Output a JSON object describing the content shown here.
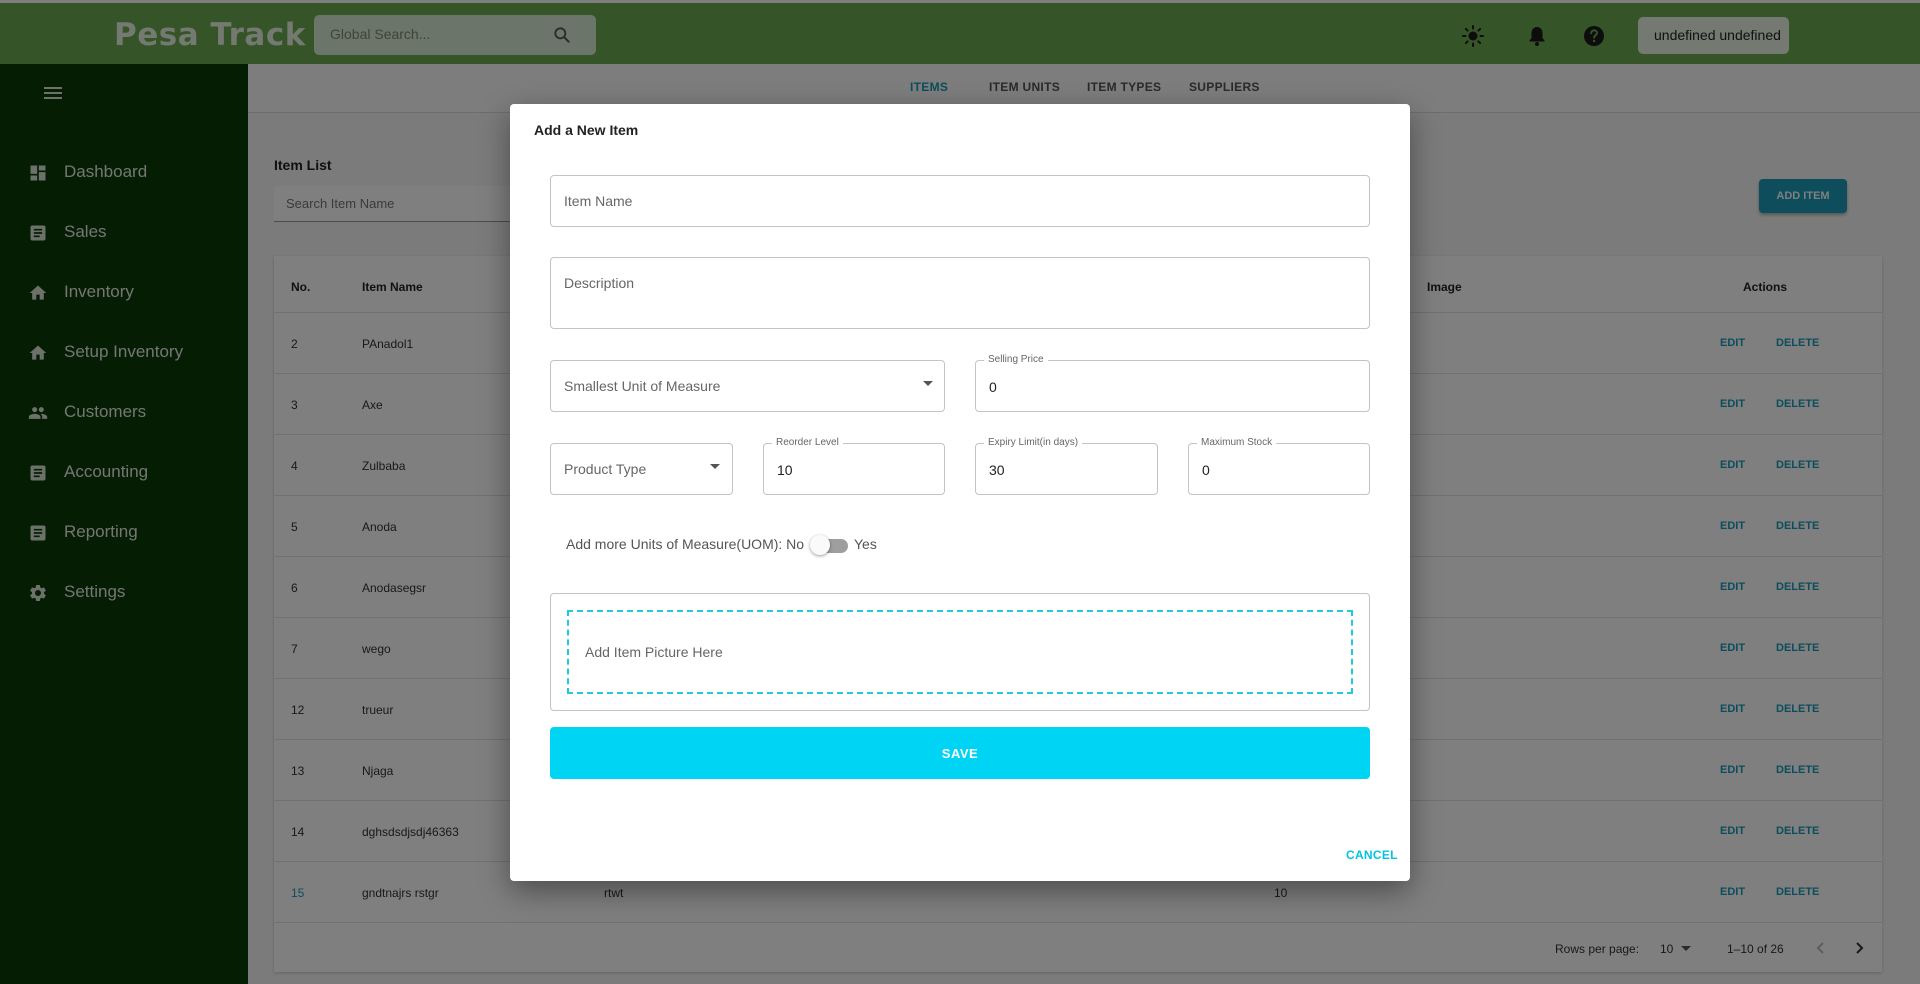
{
  "colors": {
    "header": "#6aa84f",
    "sidebar": "#0b3a05",
    "accent": "#1a9bb8",
    "save": "#00d4f5"
  },
  "header": {
    "brand": "Pesa Track",
    "search_placeholder": "Global Search...",
    "user_label": "undefined undefined",
    "icons": [
      "brightness-icon",
      "bell-icon",
      "help-icon"
    ]
  },
  "sidebar": {
    "items": [
      {
        "label": "Dashboard",
        "icon": "dashboard-icon"
      },
      {
        "label": "Sales",
        "icon": "list-icon"
      },
      {
        "label": "Inventory",
        "icon": "home-icon"
      },
      {
        "label": "Setup Inventory",
        "icon": "home-icon"
      },
      {
        "label": "Customers",
        "icon": "people-icon"
      },
      {
        "label": "Accounting",
        "icon": "list-icon"
      },
      {
        "label": "Reporting",
        "icon": "list-icon"
      },
      {
        "label": "Settings",
        "icon": "gear-icon"
      }
    ]
  },
  "tabs": [
    "ITEMS",
    "ITEM UNITS",
    "ITEM TYPES",
    "SUPPLIERS"
  ],
  "item_list": {
    "title": "Item List",
    "search_placeholder": "Search Item Name",
    "add_button": "ADD ITEM",
    "columns": {
      "no": "No.",
      "name": "Item Name",
      "image": "Image",
      "actions": "Actions"
    },
    "edit_label": "EDIT",
    "delete_label": "DELETE",
    "rows": [
      {
        "no": "2",
        "name": "PAnadol1"
      },
      {
        "no": "3",
        "name": "Axe"
      },
      {
        "no": "4",
        "name": "Zulbaba"
      },
      {
        "no": "5",
        "name": "Anoda"
      },
      {
        "no": "6",
        "name": "Anodasegsr"
      },
      {
        "no": "7",
        "name": "wego"
      },
      {
        "no": "12",
        "name": "trueur"
      },
      {
        "no": "13",
        "name": "Njaga"
      },
      {
        "no": "14",
        "name": "dghsdsdjsdj46363"
      },
      {
        "no": "15",
        "name": "gndtnajrs rstgr",
        "desc": "rtwt",
        "qty": "10"
      }
    ],
    "pager": {
      "rows_label": "Rows per page:",
      "rows_value": "10",
      "range": "1–10 of 26"
    }
  },
  "modal": {
    "title": "Add a New Item",
    "item_name_placeholder": "Item Name",
    "description_placeholder": "Description",
    "uom_placeholder": "Smallest Unit of Measure",
    "selling_price_label": "Selling Price",
    "selling_price_value": "0",
    "product_type_placeholder": "Product Type",
    "reorder_label": "Reorder Level",
    "reorder_value": "10",
    "expiry_label": "Expiry Limit(in days)",
    "expiry_value": "30",
    "max_stock_label": "Maximum Stock",
    "max_stock_value": "0",
    "uom_toggle_label": "Add more Units of Measure(UOM): No",
    "uom_toggle_yes": "Yes",
    "picture_placeholder": "Add Item Picture Here",
    "save_label": "SAVE",
    "cancel_label": "CANCEL"
  }
}
